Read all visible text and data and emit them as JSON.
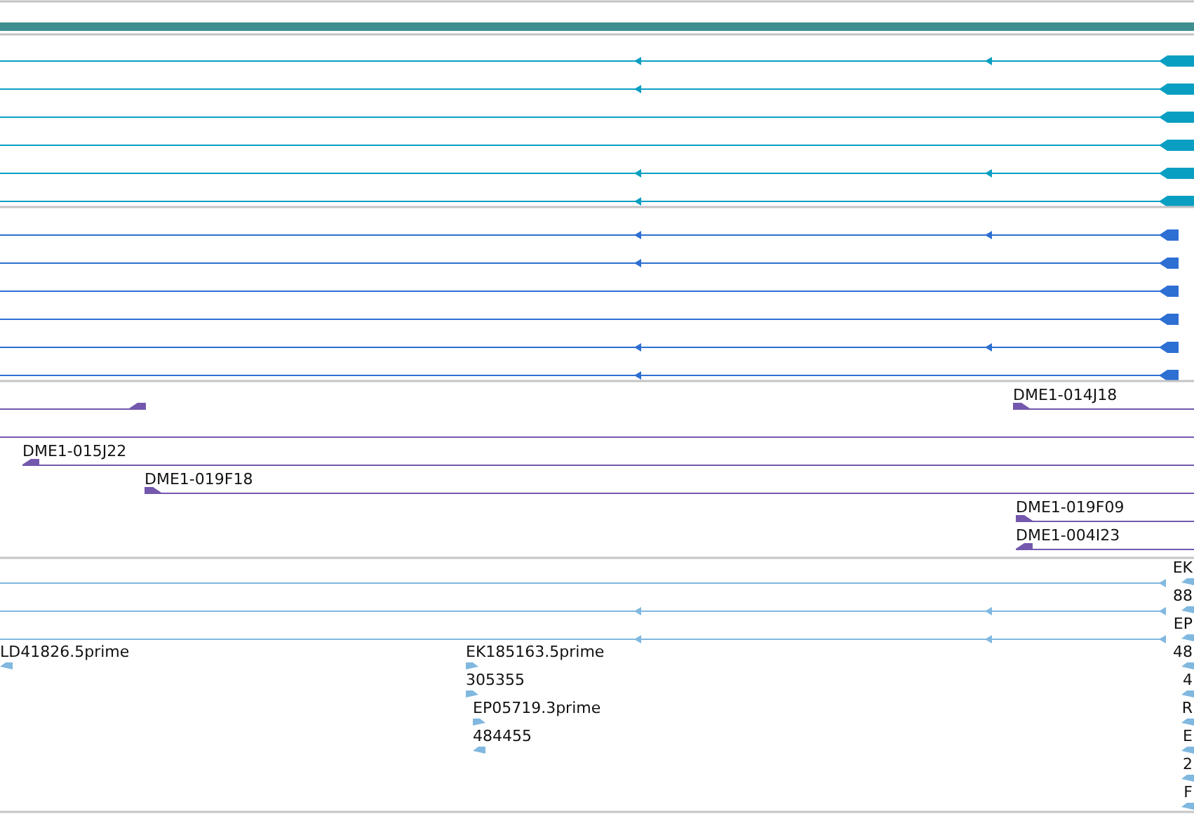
{
  "transcript_tracks": [
    {
      "color": "#0a9fc2",
      "rows": [
        {
          "kind": "long"
        },
        {
          "kind": "medium"
        },
        {
          "kind": "short"
        },
        {
          "kind": "short"
        },
        {
          "kind": "long"
        },
        {
          "kind": "medium"
        }
      ]
    },
    {
      "color": "#2d6fd2",
      "rows": [
        {
          "kind": "long"
        },
        {
          "kind": "medium"
        },
        {
          "kind": "short"
        },
        {
          "kind": "short"
        },
        {
          "kind": "long"
        },
        {
          "kind": "medium"
        }
      ]
    }
  ],
  "clone_track": {
    "color": "#7458ad",
    "features": [
      {
        "kind": "reverse"
      },
      {
        "label": "DME1-014J18",
        "kind": "forward"
      },
      {
        "kind": "plain"
      },
      {
        "label": "DME1-015J22",
        "kind": "reverse"
      },
      {
        "label": "DME1-019F18",
        "kind": "forward"
      },
      {
        "label": "DME1-019F09",
        "kind": "forward"
      },
      {
        "label": "DME1-004I23",
        "kind": "reverse"
      }
    ]
  },
  "est_track": {
    "color": "#80b8e0",
    "rows": [
      {
        "kind": "short"
      },
      {
        "kind": "long"
      },
      {
        "kind": "long"
      }
    ],
    "features": [
      {
        "label": "LD41826.5prime",
        "kind": "reverse"
      },
      {
        "label": "EK185163.5prime",
        "kind": "forward"
      },
      {
        "label": "305355",
        "kind": "forward"
      },
      {
        "label": "EP05719.3prime",
        "kind": "forward"
      },
      {
        "label": "484455",
        "kind": "reverse"
      },
      {
        "label": "EK",
        "kind": "reverse"
      },
      {
        "label": "88",
        "kind": "reverse"
      },
      {
        "label": "EP",
        "kind": "reverse"
      },
      {
        "label": "48",
        "kind": "reverse"
      },
      {
        "label": "4",
        "kind": "reverse"
      },
      {
        "label": "R",
        "kind": "reverse"
      },
      {
        "label": "E",
        "kind": "reverse"
      },
      {
        "label": "2",
        "kind": "reverse"
      },
      {
        "label": "F",
        "kind": "reverse"
      }
    ]
  }
}
